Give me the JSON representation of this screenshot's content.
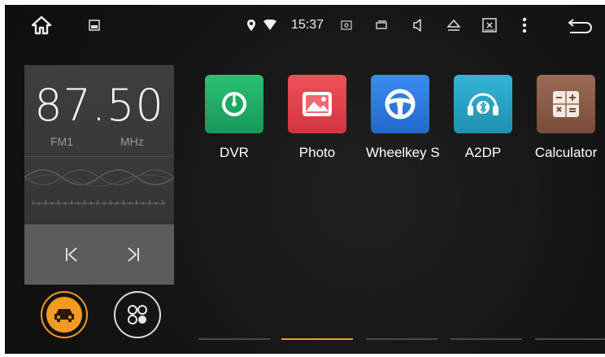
{
  "status_bar": {
    "time": "15:37",
    "icons": [
      "home-icon",
      "gallery-icon",
      "location-icon",
      "wifi-icon",
      "screenshot-icon",
      "window-icon",
      "volume-icon",
      "eject-icon",
      "close-box-icon",
      "menu-dots-icon",
      "back-icon"
    ]
  },
  "radio": {
    "frequency": "87.50",
    "band": "FM1",
    "unit": "MHz",
    "prev_label": "|<",
    "next_label": ">|"
  },
  "apps": [
    {
      "label": "DVR",
      "icon": "dvr-gauge-icon",
      "color": "#1fae64"
    },
    {
      "label": "Photo",
      "icon": "photo-icon",
      "color": "#e24048"
    },
    {
      "label": "Wheelkey S",
      "icon": "steering-wheel-icon",
      "color": "#2f7be0"
    },
    {
      "label": "A2DP",
      "icon": "bluetooth-audio-icon",
      "color": "#2a9dc0"
    },
    {
      "label": "Calculator",
      "icon": "calculator-icon",
      "color": "#8a5a46"
    }
  ],
  "pager": {
    "pages": 5,
    "active": 2,
    "active_color": "#f29a22"
  },
  "colors": {
    "car_button": "#f29a22",
    "background": "#151515"
  }
}
